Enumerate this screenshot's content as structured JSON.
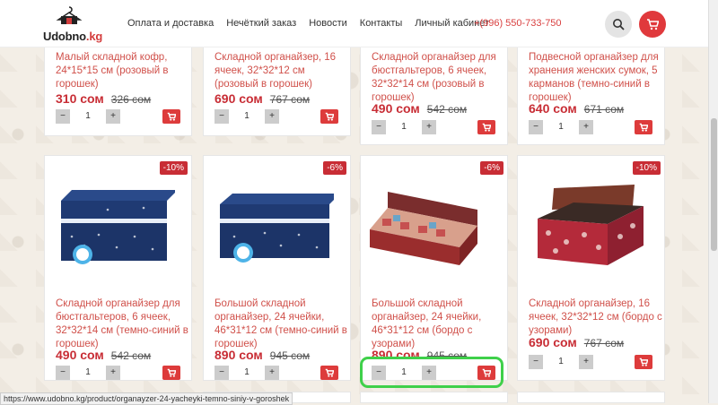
{
  "header": {
    "logo_name": "Udobno",
    "logo_tld": ".kg",
    "nav": [
      "Оплата и доставка",
      "Нечёткий заказ",
      "Новости",
      "Контакты",
      "Личный кабинет"
    ],
    "phone": "+(996) 550-733-750"
  },
  "row1": [
    {
      "title": "Малый складной кофр, 24*15*15 см (розовый в горошек)",
      "price": "310 сом",
      "old": "326 сом",
      "qty": "1"
    },
    {
      "title": "Складной органайзер, 16 ячеек, 32*32*12 см (розовый в горошек)",
      "price": "690 сом",
      "old": "767 сом",
      "qty": "1"
    },
    {
      "title": "Складной органайзер для бюстгальтеров, 6 ячеек, 32*32*14 см (розовый в горошек)",
      "price": "490 сом",
      "old": "542 сом",
      "qty": "1"
    },
    {
      "title": "Подвесной органайзер для хранения женских сумок, 5 карманов (темно-синий в горошек)",
      "price": "640 сом",
      "old": "671 сом",
      "qty": "1"
    }
  ],
  "row2": [
    {
      "badge": "-10%",
      "title": "Складной органайзер для бюстгальтеров, 6 ячеек, 32*32*14 см (темно-синий в горошек)",
      "price": "490 сом",
      "old": "542 сом",
      "qty": "1"
    },
    {
      "badge": "-6%",
      "title": "Большой складной органайзер, 24 ячейки, 46*31*12 см (темно-синий в горошек)",
      "price": "890 сом",
      "old": "945 сом",
      "qty": "1"
    },
    {
      "badge": "-6%",
      "title": "Большой складной органайзер, 24 ячейки, 46*31*12 см (бордо с узорами)",
      "price": "890 сом",
      "old": "945 сом",
      "qty": "1"
    },
    {
      "badge": "-10%",
      "title": "Складной органайзер, 16 ячеек, 32*32*12 см (бордо с узорами)",
      "price": "690 сом",
      "old": "767 сом",
      "qty": "1"
    }
  ],
  "controls": {
    "minus": "−",
    "plus": "+"
  },
  "status_url": "https://www.udobno.kg/product/organayzer-24-yacheyki-temno-siniy-v-goroshek",
  "colors": {
    "accent": "#d94040",
    "highlight": "#3fd04a"
  }
}
